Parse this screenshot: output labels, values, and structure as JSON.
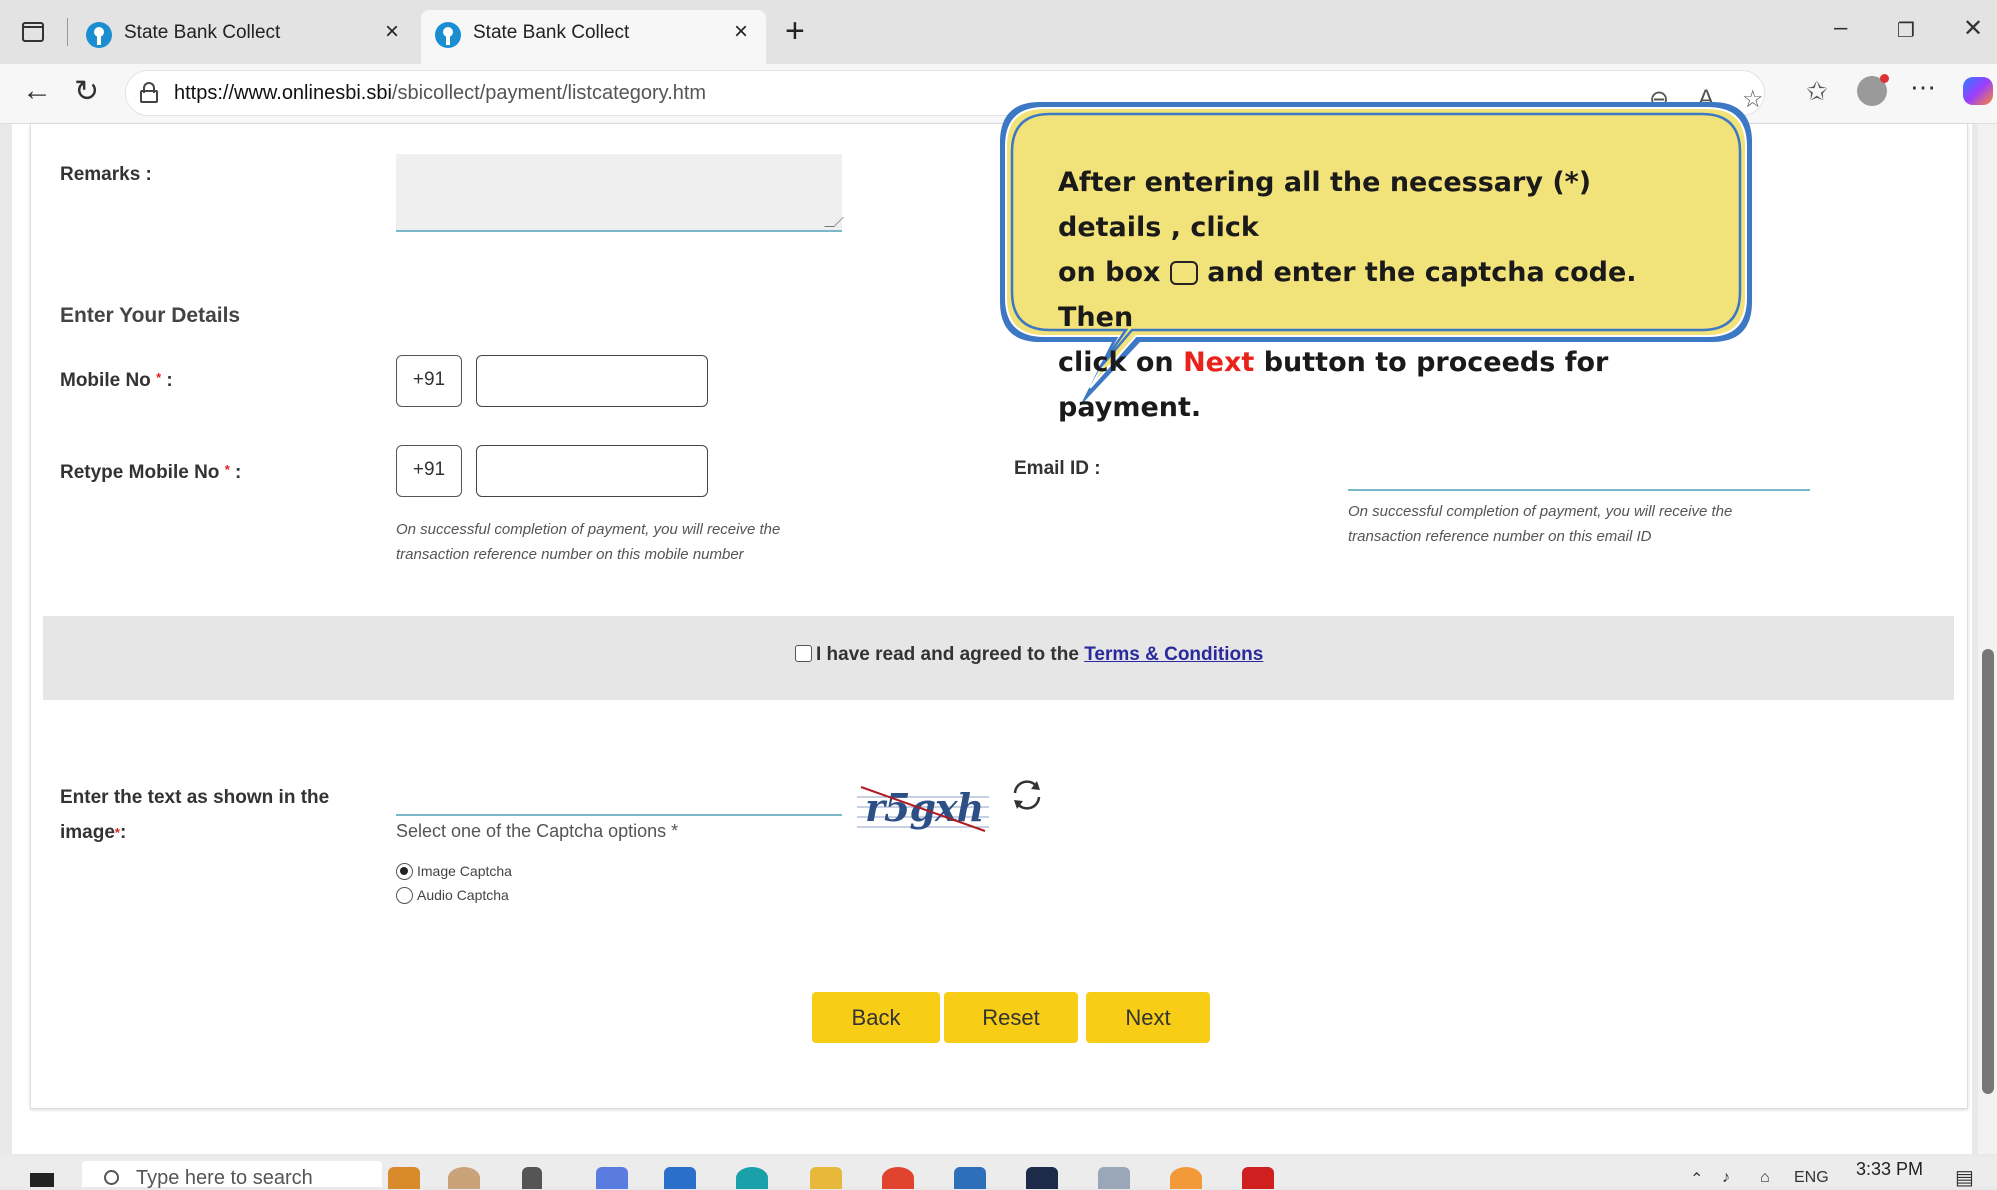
{
  "browser": {
    "tabs": [
      {
        "title": "State Bank Collect",
        "active": false
      },
      {
        "title": "State Bank Collect",
        "active": true
      }
    ],
    "new_tab_symbol": "+",
    "close_symbol": "×",
    "url_host": "https://www.onlinesbi.sbi",
    "url_path": "/sbicollect/payment/listcategory.htm",
    "window_controls": {
      "minimize": "–",
      "restore": "❐",
      "close": "✕"
    }
  },
  "form": {
    "remarks_label": "Remarks :",
    "section_title": "Enter Your Details",
    "mobile_label": "Mobile No",
    "retype_mobile_label": "Retype Mobile No",
    "required_mark": "*",
    "colon": ":",
    "country_code": "+91",
    "mobile_hint_line1": "On successful completion of payment, you will receive the",
    "mobile_hint_line2": "transaction reference number on this mobile number",
    "email_label": "Email ID :",
    "email_hint_line1": "On successful completion of payment, you will receive the",
    "email_hint_line2": "transaction reference number on this email ID",
    "terms_prefix": "I have read and agreed to the",
    "terms_link": "Terms & Conditions",
    "captcha_label_line1": "Enter the text as shown in the",
    "captcha_label_line2": "image",
    "captcha_select_text": "Select one of the Captcha options *",
    "captcha_options": [
      {
        "label": "Image Captcha",
        "selected": true
      },
      {
        "label": "Audio Captcha",
        "selected": false
      }
    ],
    "captcha_image_text": "r5gxh",
    "buttons": {
      "back": "Back",
      "reset": "Reset",
      "next": "Next"
    }
  },
  "callout": {
    "line1": "After entering all the necessary (*) details , click",
    "line2_a": "on box",
    "line2_b": "and enter the captcha code. Then",
    "line3_a": "click on",
    "line3_next": "Next",
    "line3_b": "button to proceeds for payment.",
    "fill_color": "#f2e27a",
    "border_color": "#3d78c4"
  },
  "taskbar": {
    "search_placeholder": "Type here to search",
    "lang": "ENG",
    "time": "3:33 PM"
  },
  "colors": {
    "button_yellow": "#f8cd16",
    "required_red": "#e02020",
    "link_blue": "#2a2a9c",
    "underline_teal": "#7ab7c8"
  }
}
